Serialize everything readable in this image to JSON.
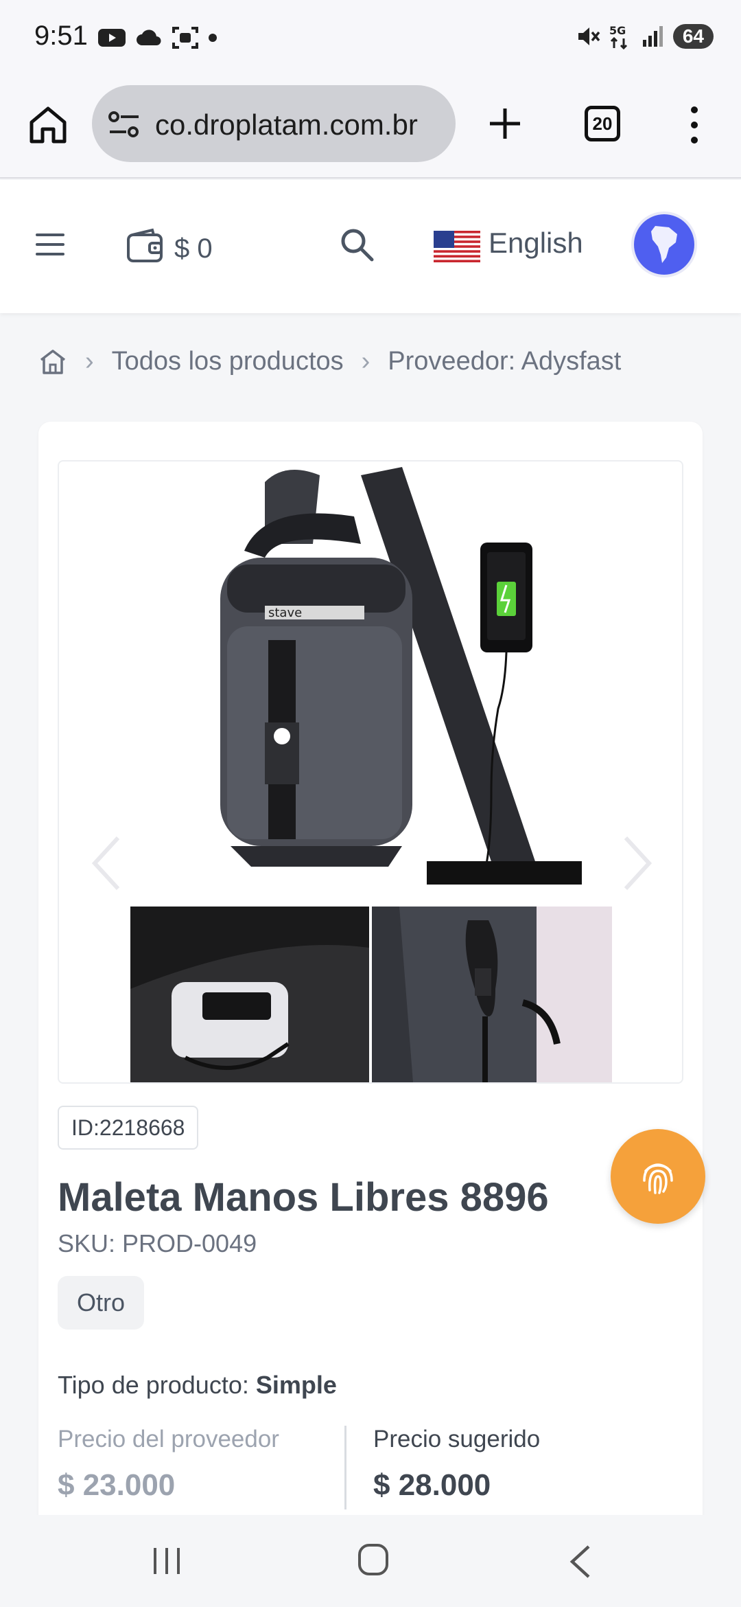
{
  "status_bar": {
    "time": "9:51",
    "battery": "64",
    "icons": [
      "youtube-icon",
      "cloud-icon",
      "screenshot-icon",
      "dot-icon",
      "mute-icon",
      "5g-icon",
      "signal-icon",
      "battery-icon"
    ]
  },
  "browser": {
    "url": "co.droplatam.com.br",
    "tab_count": "20"
  },
  "header": {
    "wallet_amount": "$ 0",
    "language": "English"
  },
  "breadcrumb": {
    "items": [
      "Todos los productos",
      "Proveedor: Adysfast"
    ]
  },
  "product": {
    "id_label": "ID:2218668",
    "title": "Maleta Manos Libres 8896",
    "sku": "SKU: PROD-0049",
    "tag": "Otro",
    "type_label": "Tipo de producto:",
    "type_value": "Simple",
    "supplier_price_label": "Precio del proveedor",
    "supplier_price": "$ 23.000",
    "suggested_price_label": "Precio sugerido",
    "suggested_price": "$ 28.000",
    "image_text": "stave"
  },
  "colors": {
    "accent_orange": "#f5a13b",
    "region_blue": "#4f5ff0",
    "text_dark": "#3f4650",
    "text_muted": "#9ca3af"
  }
}
